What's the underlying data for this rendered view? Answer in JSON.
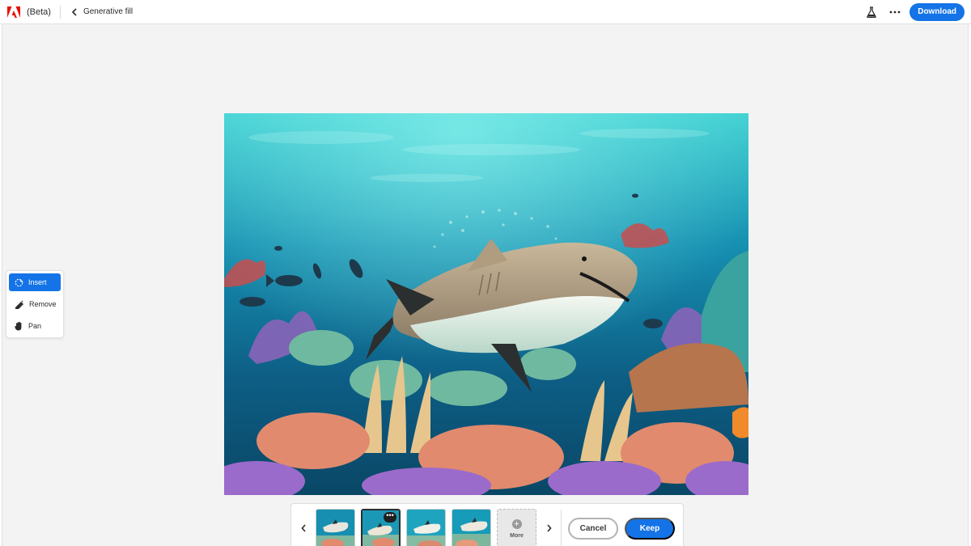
{
  "header": {
    "beta_label": "(Beta)",
    "title": "Generative fill",
    "download_label": "Download"
  },
  "toolbar": {
    "items": [
      {
        "label": "Insert",
        "icon": "insert-icon",
        "active": true
      },
      {
        "label": "Remove",
        "icon": "remove-icon",
        "active": false
      },
      {
        "label": "Pan",
        "icon": "hand-icon",
        "active": false
      }
    ]
  },
  "canvas": {
    "icon": "underwater-shark-image"
  },
  "variations": {
    "thumbs": [
      {
        "icon": "variation-thumbnail-1",
        "selected": false
      },
      {
        "icon": "variation-thumbnail-2",
        "selected": true
      },
      {
        "icon": "variation-thumbnail-3",
        "selected": false
      },
      {
        "icon": "variation-thumbnail-4",
        "selected": false
      }
    ],
    "more_label": "More"
  },
  "actions": {
    "cancel_label": "Cancel",
    "keep_label": "Keep"
  },
  "colors": {
    "accent": "#1473e6",
    "adobe_red": "#eb1000"
  }
}
